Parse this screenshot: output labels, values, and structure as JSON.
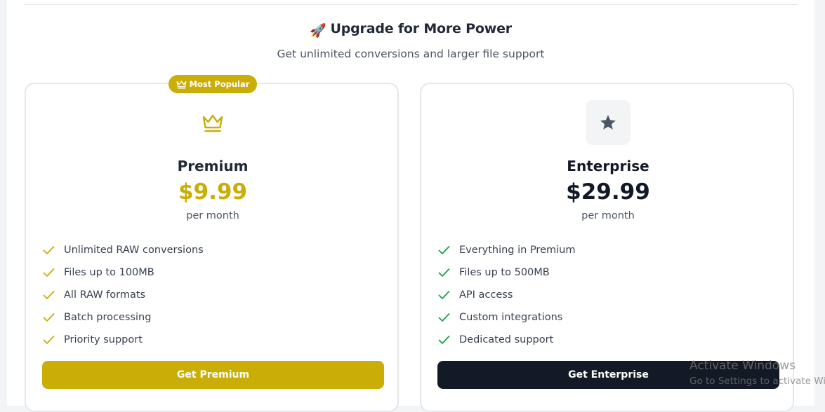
{
  "header": {
    "emoji": "🚀",
    "title": "Upgrade for More Power",
    "subtitle": "Get unlimited conversions and larger file support"
  },
  "plans": [
    {
      "badge": "Most Popular",
      "icon": "crown-icon",
      "name": "Premium",
      "price": "$9.99",
      "period": "per month",
      "features": [
        "Unlimited RAW conversions",
        "Files up to 100MB",
        "All RAW formats",
        "Batch processing",
        "Priority support"
      ],
      "cta": "Get Premium",
      "accent": "#caad06"
    },
    {
      "icon": "star-icon",
      "name": "Enterprise",
      "price": "$29.99",
      "period": "per month",
      "features": [
        "Everything in Premium",
        "Files up to 500MB",
        "API access",
        "Custom integrations",
        "Dedicated support"
      ],
      "cta": "Get Enterprise",
      "accent": "#131a26"
    }
  ],
  "watermark": {
    "line1": "Activate Windows",
    "line2": "Go to Settings to activate Windows."
  },
  "colors": {
    "gold": "#caad06",
    "dark": "#131a26",
    "check_premium": "#caad06",
    "check_enterprise": "#16a34a"
  }
}
